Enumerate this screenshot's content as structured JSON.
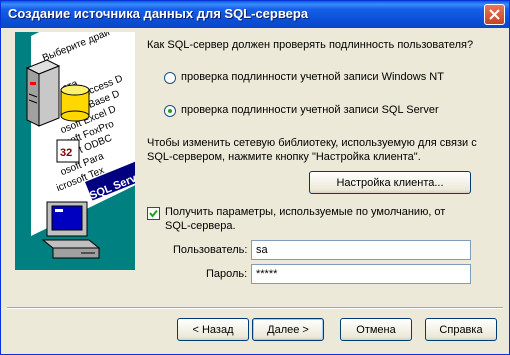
{
  "window": {
    "title": "Создание источника данных для SQL-сервера"
  },
  "illustration": {
    "items": [
      "Выберите драй",
      "ата",
      "osoft Access D",
      "osoft dBase D",
      "osoft Excel D",
      "osoft FoxPro",
      "rosoft ODBC",
      "osoft Para",
      "icrosoft Tex"
    ],
    "selected": "SQL Serve",
    "badge": "32"
  },
  "question": "Как SQL-сервер должен проверять подлинность пользователя?",
  "auth_options": [
    {
      "label": "проверка подлинности учетной записи Windows NT",
      "selected": false
    },
    {
      "label": "проверка подлинности учетной записи SQL Server",
      "selected": true
    }
  ],
  "network_info": {
    "line1": "Чтобы изменить сетевую библиотеку, используемую для связи с",
    "line2": "SQL-сервером, нажмите кнопку \"Настройка клиента\"."
  },
  "client_config_button": "Настройка клиента...",
  "defaults_checkbox": {
    "checked": true,
    "line1": "Получить параметры, используемые по умолчанию, от",
    "line2": "SQL-сервера."
  },
  "login": {
    "label": "Пользователь:",
    "value": "sa"
  },
  "password": {
    "label": "Пароль:",
    "value": "*****"
  },
  "buttons": {
    "back": "< Назад",
    "next": "Далее >",
    "cancel": "Отмена",
    "help": "Справка"
  }
}
